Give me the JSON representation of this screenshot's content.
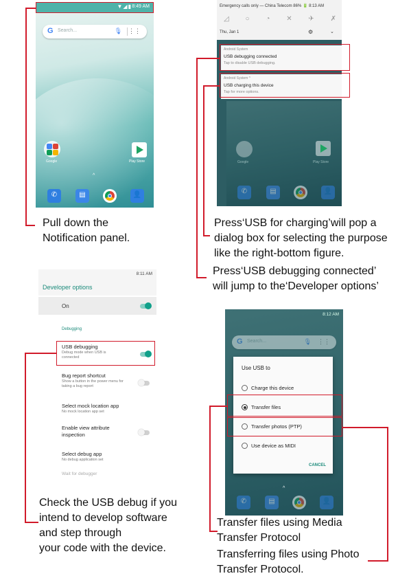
{
  "home": {
    "status_time": "8:49 AM",
    "search_placeholder": "Search...",
    "apps": [
      "Google",
      "Play Store"
    ]
  },
  "notifications": {
    "emergency_text": "Emergency calls only — China Telecom 86% 🔋 8:13 AM",
    "date": "Thu, Jan 1",
    "usb_debug": {
      "source": "Android System",
      "title": "USB debugging connected",
      "subtitle": "Tap to disable USB debugging."
    },
    "usb_charge": {
      "source": "Android System ^",
      "title": "USB charging this device",
      "subtitle": "Tap for more options."
    },
    "apps": [
      "Google",
      "Play Store"
    ]
  },
  "developer_options": {
    "status_time": "8:11 AM",
    "title": "Developer options",
    "master_label": "On",
    "section": "Debugging",
    "items": [
      {
        "title": "USB debugging",
        "subtitle": "Debug mode when USB is connected"
      },
      {
        "title": "Bug report shortcut",
        "subtitle": "Show a button in the power menu for taking a bug report"
      },
      {
        "title": "Select mock location app",
        "subtitle": "No mock location app set"
      },
      {
        "title": "Enable view attribute inspection",
        "subtitle": ""
      },
      {
        "title": "Select debug app",
        "subtitle": "No debug application set"
      }
    ],
    "wait_label": "Wait for debugger"
  },
  "usb_dialog": {
    "status_time": "8:12 AM",
    "search_placeholder": "Search...",
    "title": "Use USB to",
    "options": [
      "Charge this device",
      "Transfer files",
      "Transfer photos (PTP)",
      "Use device as MIDI"
    ],
    "selected": "Transfer files",
    "cancel": "CANCEL"
  },
  "captions": {
    "pull_down": [
      "Pull down the",
      "Notification panel."
    ],
    "usb_charging": [
      "Press‘USB for charging’will pop a",
      "dialog box for selecting the purpose",
      "like the right-bottom figure."
    ],
    "usb_debugging": [
      "Press‘USB debugging connected’",
      "will jump to the‘Developer options’"
    ],
    "check_debug": [
      "Check the USB debug if you",
      "intend to develop software",
      "and step through",
      "your code with the device."
    ],
    "mtp": [
      "Transfer files using Media",
      "Transfer Protocol"
    ],
    "ptp": [
      "Transferring files using Photo",
      "Transfer Protocol."
    ]
  },
  "colors": {
    "highlight": "#d11a2a",
    "accent_teal": "#10a08a"
  }
}
